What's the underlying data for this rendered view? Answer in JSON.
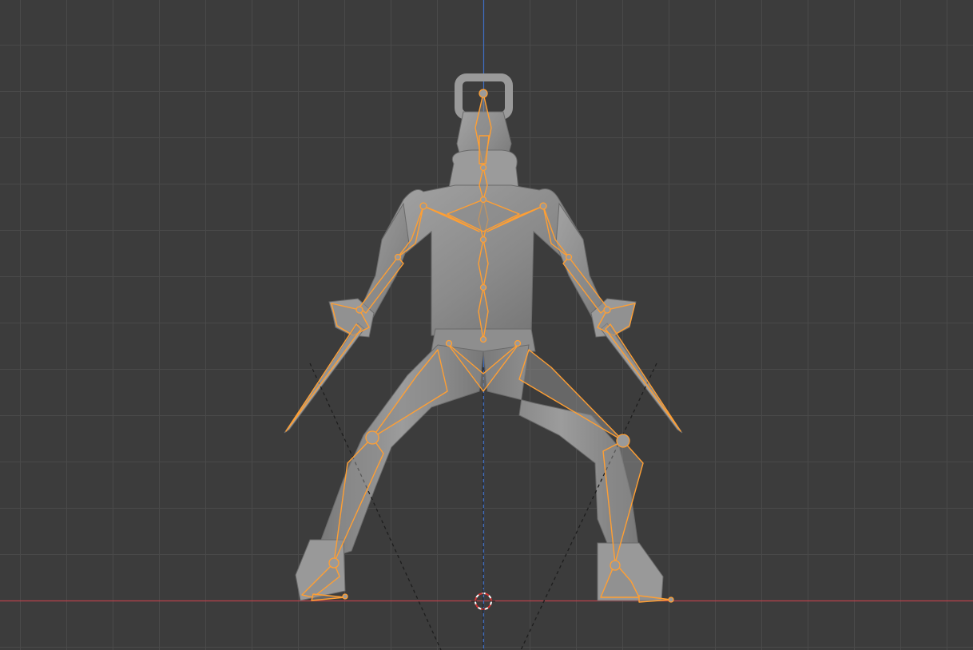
{
  "viewport": {
    "background": "#3c3c3c",
    "grid_color": "#4a4a4a",
    "x_axis_color": "#b8424a",
    "z_axis_color": "#3f70c8",
    "rig_outline_color": "#ff9f33",
    "mesh_color": "#8c8c8c",
    "cursor_icon": "3d-cursor-icon",
    "view": "front-orthographic"
  }
}
